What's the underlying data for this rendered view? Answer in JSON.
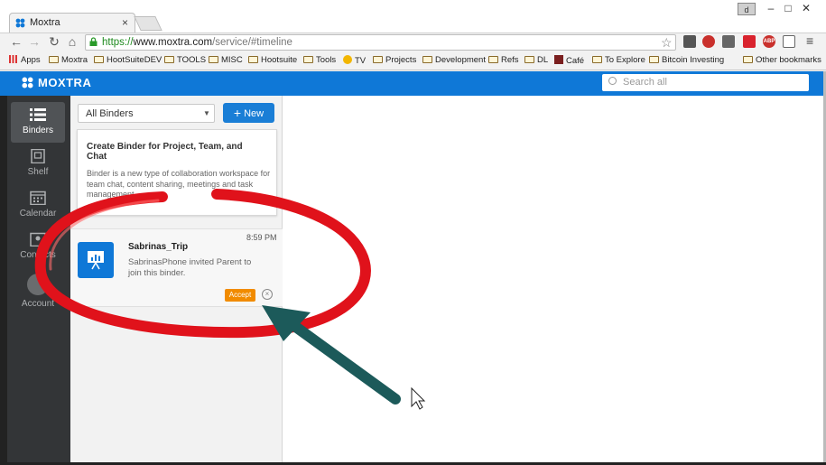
{
  "browser": {
    "tab_title": "Moxtra",
    "tab_close": "×",
    "user_badge": "d",
    "url_proto": "https://",
    "url_host": "www.moxtra.com",
    "url_path": "/service/#timeline",
    "bookmarks": [
      "Apps",
      "Moxtra",
      "HootSuiteDEV",
      "TOOLS",
      "MISC",
      "Hootsuite",
      "Tools",
      "TV",
      "Projects",
      "Development",
      "Refs",
      "DL",
      "Café",
      "To Explore",
      "Bitcoin Investing",
      "Other bookmarks"
    ],
    "ext_badges": [
      "ABP"
    ]
  },
  "app": {
    "logo": "MOXTRA",
    "search_placeholder": "Search all",
    "nav": [
      {
        "label": "Binders"
      },
      {
        "label": "Shelf"
      },
      {
        "label": "Calendar"
      },
      {
        "label": "Contacts"
      },
      {
        "label": "Account"
      }
    ],
    "binder_filter": "All Binders",
    "new_button": "New",
    "tip": {
      "title": "Create Binder for Project, Team, and Chat",
      "body": "Binder is a new type of collaboration workspace for team chat, content sharing, meetings and task management."
    },
    "invite": {
      "time": "8:59 PM",
      "name": "Sabrinas_Trip",
      "message": "SabrinasPhone invited Parent to join this binder.",
      "accept": "Accept"
    }
  },
  "colors": {
    "brand_blue": "#0f78d7",
    "accept_orange": "#f18b00",
    "annotation_red": "#e0121b",
    "annotation_arrow": "#1c5a5a"
  }
}
